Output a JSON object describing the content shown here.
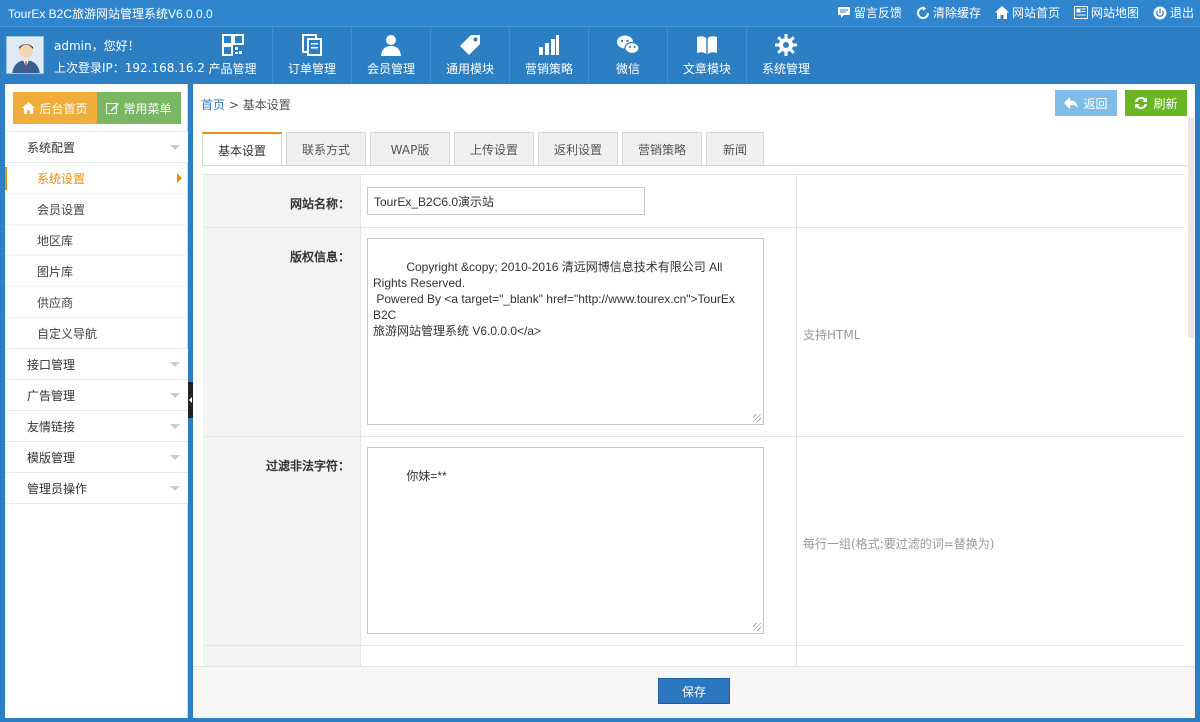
{
  "app": {
    "title": "TourEx B2C旅游网站管理系统V6.0.0.0"
  },
  "toplinks": [
    {
      "label": "留言反馈",
      "icon": "comment-icon"
    },
    {
      "label": "清除缓存",
      "icon": "refresh-icon"
    },
    {
      "label": "网站首页",
      "icon": "home-icon"
    },
    {
      "label": "网站地图",
      "icon": "sitemap-icon"
    },
    {
      "label": "退出",
      "icon": "power-icon"
    }
  ],
  "user": {
    "greeting": "admin，您好！",
    "last_login_label": "上次登录IP：",
    "last_login_ip": "192.168.16.2"
  },
  "mainnav": [
    {
      "label": "产品管理",
      "icon": "grid-icon"
    },
    {
      "label": "订单管理",
      "icon": "orders-icon"
    },
    {
      "label": "会员管理",
      "icon": "user-icon"
    },
    {
      "label": "通用模块",
      "icon": "tag-icon"
    },
    {
      "label": "营销策略",
      "icon": "bar-chart-icon"
    },
    {
      "label": "微信",
      "icon": "wechat-icon"
    },
    {
      "label": "文章模块",
      "icon": "book-icon"
    },
    {
      "label": "系统管理",
      "icon": "gear-icon"
    }
  ],
  "sidebar": {
    "home_button": "后台首页",
    "fav_button": "常用菜单",
    "groups": [
      {
        "label": "系统配置",
        "items": [
          "系统设置",
          "会员设置",
          "地区库",
          "图片库",
          "供应商",
          "自定义导航"
        ]
      },
      {
        "label": "接口管理"
      },
      {
        "label": "广告管理"
      },
      {
        "label": "友情链接"
      },
      {
        "label": "模版管理"
      },
      {
        "label": "管理员操作"
      }
    ]
  },
  "breadcrumb": {
    "home": "首页",
    "sep": ">",
    "current": "基本设置"
  },
  "toolbar": {
    "back": "返回",
    "refresh": "刷新"
  },
  "tabs": [
    "基本设置",
    "联系方式",
    "WAP版",
    "上传设置",
    "返利设置",
    "营销策略",
    "新闻"
  ],
  "form": {
    "site_name": {
      "label": "网站名称：",
      "value": "TourEx_B2C6.0演示站"
    },
    "copyright": {
      "label": "版权信息：",
      "value": "Copyright &copy; 2010-2016 清远网博信息技术有限公司 All Rights Reserved.\n Powered By <a target=\"_blank\" href=\"http://www.tourex.cn\">TourEx B2C\n旅游网站管理系统 V6.0.0.0</a>",
      "hint": "支持HTML"
    },
    "filter": {
      "label": "过滤非法字符：",
      "value": "你妹=**",
      "hint": "每行一组(格式:要过滤的词=替换为)"
    }
  },
  "save_button": "保存"
}
